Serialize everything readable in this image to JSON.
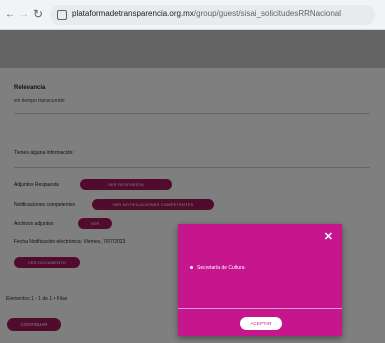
{
  "browser": {
    "url_domain": "plataformadetransparencia.org.mx",
    "url_path": "/group/guest/sisai_solicitudesRRNacional"
  },
  "form": {
    "section_title": "Relevancia",
    "section_value": "sin tiempo transcurrido",
    "extra_info_label": "Tienes alguna información:",
    "rows": [
      {
        "label": "Adjuntos Respuesta",
        "button": "VER RESPUESTA"
      },
      {
        "label": "Notificaciones competentes",
        "button": "VER NOTIFICACIONES COMPETENTES"
      },
      {
        "label": "Archivos adjuntos",
        "button": "VER"
      }
    ],
    "fecha_label": "Fecha Notificación electrónica: Viernes, 7/07/2023",
    "doc_button": "VER DOCUMENTO",
    "pagination": "Elementos 1 - 1 de 1 • Filas",
    "bottom_button": "CONTINUAR"
  },
  "modal": {
    "items": [
      "Secretaría de Cultura"
    ],
    "accept_label": "ACEPTAR"
  },
  "colors": {
    "modal_bg": "#c6168d",
    "pill": "#a3195b"
  }
}
